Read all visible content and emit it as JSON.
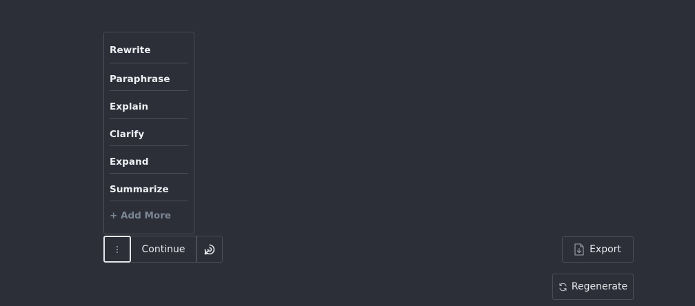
{
  "menu": {
    "items": [
      {
        "label": "Rewrite"
      },
      {
        "label": "Paraphrase"
      },
      {
        "label": "Explain"
      },
      {
        "label": "Clarify"
      },
      {
        "label": "Expand"
      },
      {
        "label": "Summarize"
      }
    ],
    "add_more_label": "+ Add More"
  },
  "toolbar": {
    "more_icon": "vertical-ellipsis-icon",
    "continue_label": "Continue",
    "continue_icon": "spiral-arrow-icon"
  },
  "actions": {
    "export_label": "Export",
    "export_icon": "file-download-icon",
    "regenerate_label": "Regenerate",
    "regenerate_icon": "refresh-icon"
  },
  "colors": {
    "background": "#2d2f38",
    "border": "#4a4c57",
    "text": "#e8e9ee",
    "muted": "#7b8794"
  }
}
